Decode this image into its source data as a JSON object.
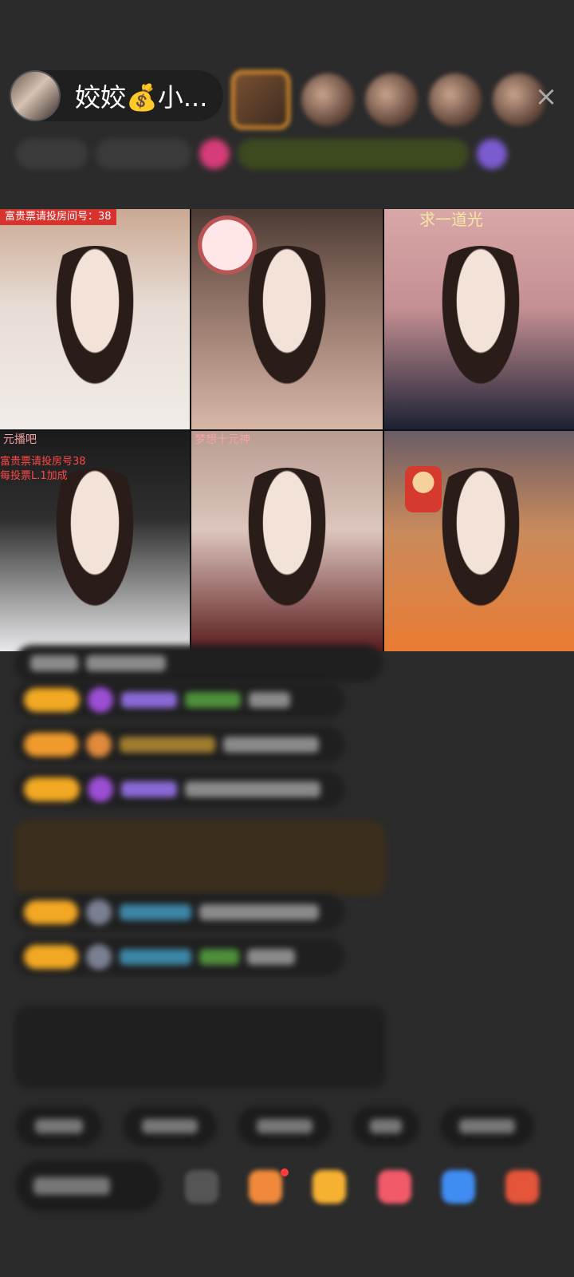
{
  "host": {
    "name": "姣姣",
    "money_icon": "💰",
    "suffix": "小..."
  },
  "header": {
    "close_label": "×"
  },
  "grid": [
    {
      "label": "富贵票请投房间号：38"
    },
    {
      "label": ""
    },
    {
      "label": "求一道光"
    },
    {
      "label": "元播吧",
      "label2": "富贵票请投房号38\n每投票L.1加成"
    },
    {
      "label": "梦想十元神"
    },
    {
      "label": ""
    }
  ],
  "colors": {
    "accent": "#f2a823",
    "bg": "#2b2b2b",
    "close": "#aaaaaa"
  }
}
